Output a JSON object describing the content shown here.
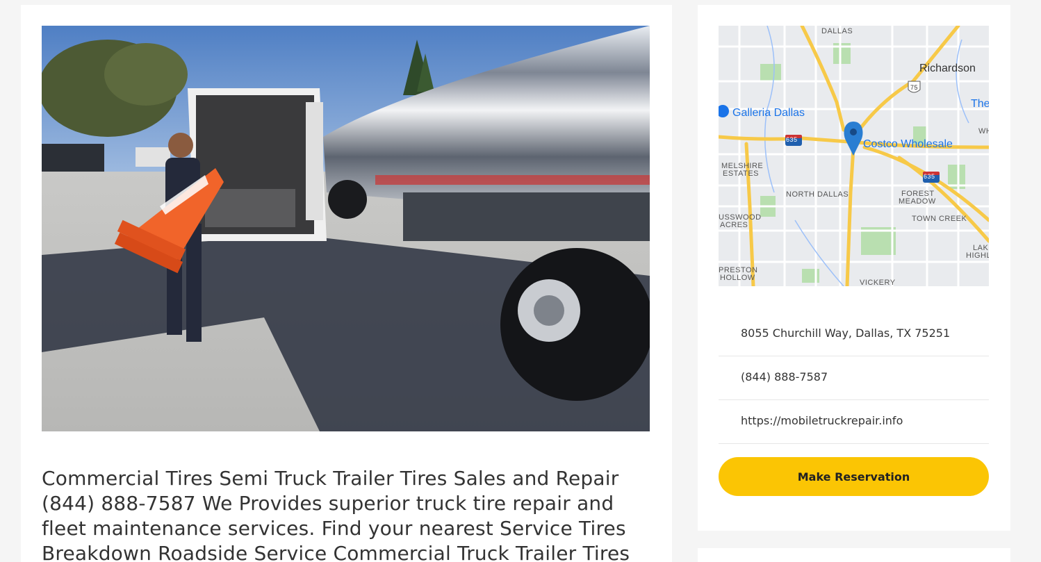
{
  "main": {
    "description": "Commercial Tires Semi Truck Trailer Tires Sales and Repair (844) 888-7587 We Provides superior truck tire repair and fleet maintenance services. Find your nearest Service Tires Breakdown Roadside Service Commercial Truck Trailer Tires"
  },
  "map": {
    "labels": {
      "dallas": "DALLAS",
      "richardson": "Richardson",
      "galleria": "Galleria Dallas",
      "costco": "Costco Wholesale",
      "the": "The",
      "wh": "WH",
      "melshire": "MELSHIRE",
      "estates": "ESTATES",
      "north_dallas": "NORTH DALLAS",
      "forest": "FOREST",
      "meadow": "MEADOW",
      "town_creek": "TOWN CREEK",
      "usswood": "USSWOOD",
      "acres": "ACRES",
      "lak": "LAK",
      "highla": "HIGHLA",
      "preston": "PRESTON",
      "hollow": "HOLLOW",
      "vickery": "VICKERY",
      "shield_75": "75",
      "shield_635a": "635",
      "shield_635b": "635"
    }
  },
  "sidebar": {
    "address": "8055 Churchill Way, Dallas, TX 75251",
    "phone": "(844) 888-7587",
    "website": "https://mobiletruckrepair.info",
    "reserve_label": "Make Reservation"
  },
  "colors": {
    "accent": "#fbc504",
    "map_pin": "#2a7ed2"
  }
}
